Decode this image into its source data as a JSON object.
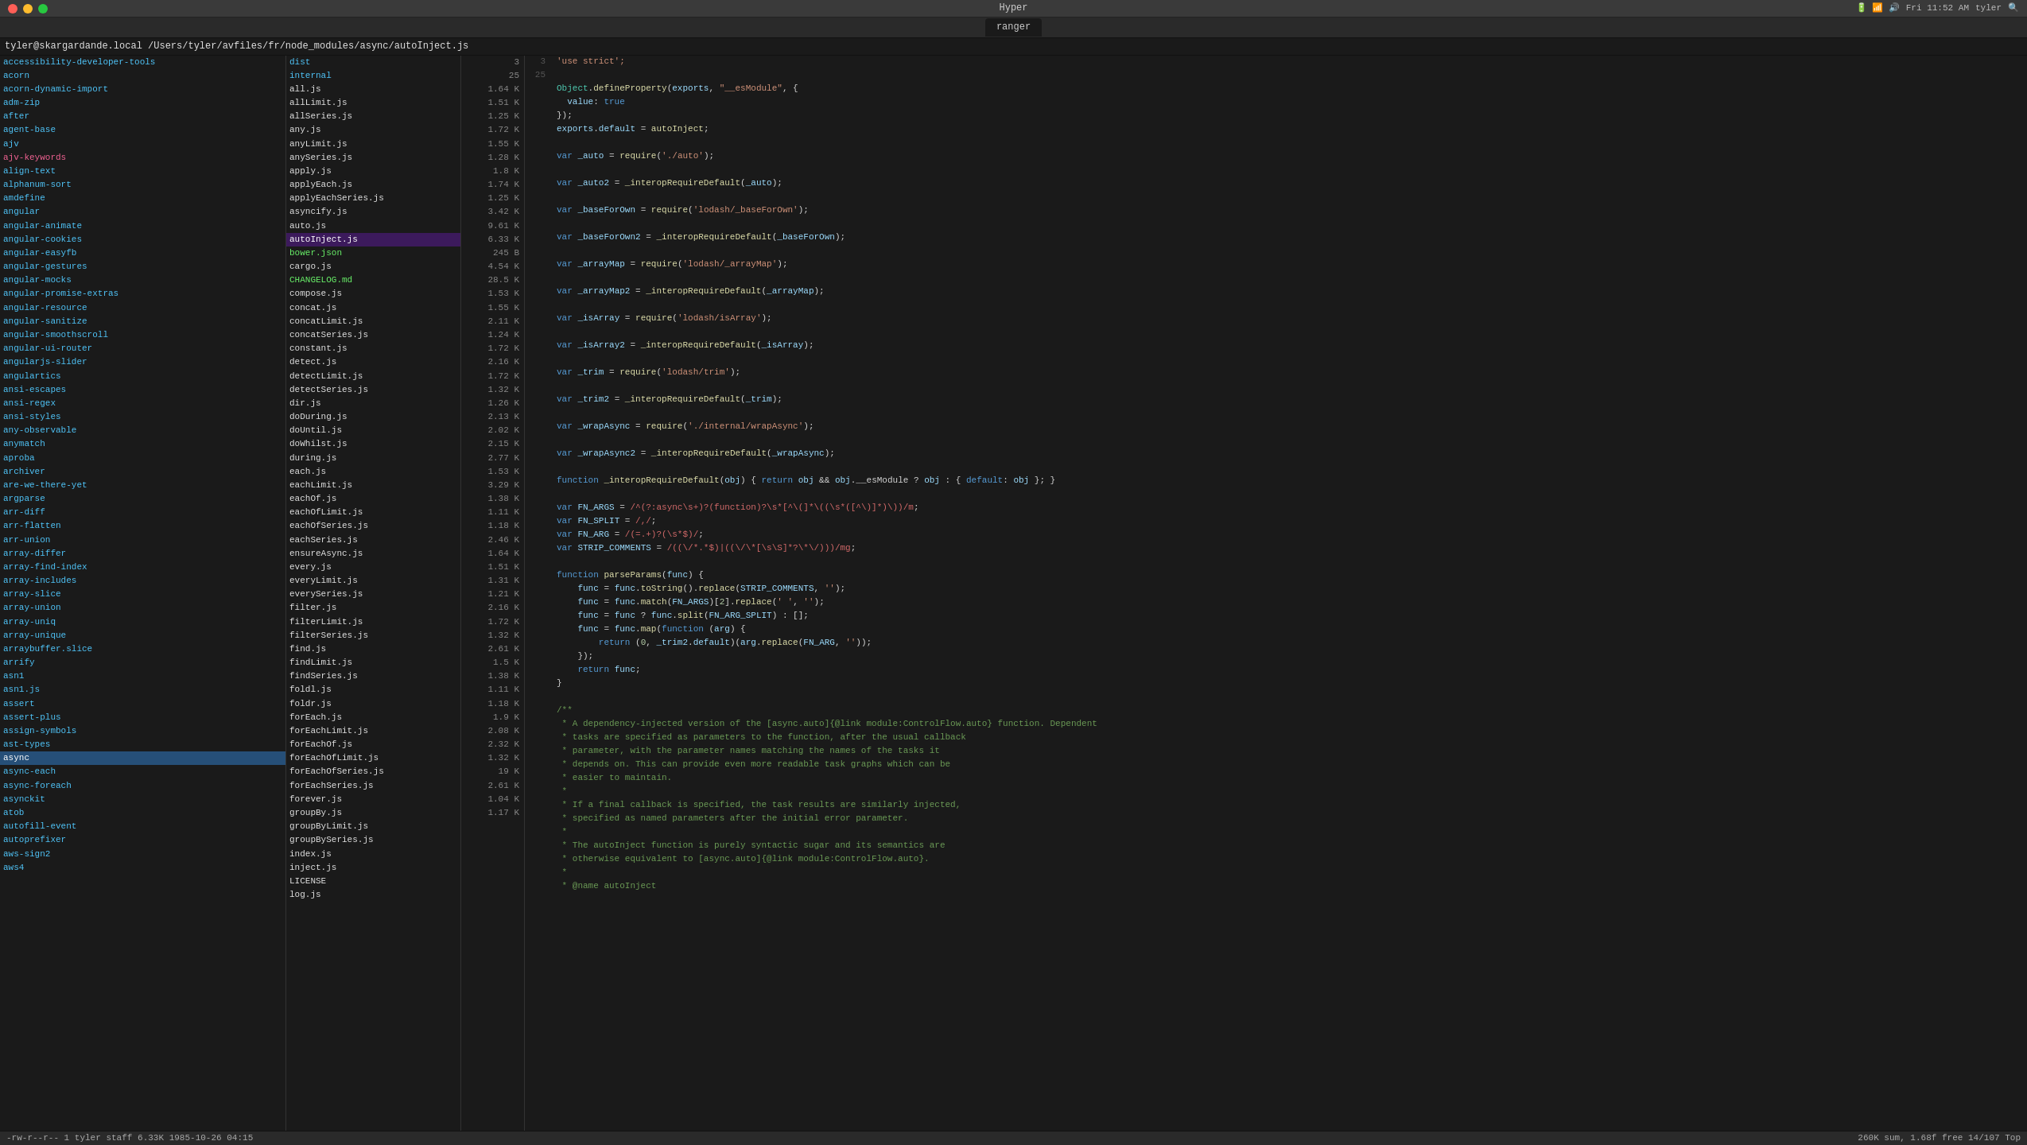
{
  "titlebar": {
    "app_name": "Hyper",
    "time": "Fri 11:52 AM",
    "tab_label": "ranger"
  },
  "pathbar": {
    "text": "tyler@skargardande.local /Users/tyler/avfiles/fr/node_modules/async/autoInject.js"
  },
  "left_files": [
    {
      "name": "accessibility-developer-tools",
      "color": "cyan"
    },
    {
      "name": "acorn",
      "color": "cyan"
    },
    {
      "name": "acorn-dynamic-import",
      "color": "cyan"
    },
    {
      "name": "adm-zip",
      "color": "cyan"
    },
    {
      "name": "after",
      "color": "cyan"
    },
    {
      "name": "agent-base",
      "color": "cyan"
    },
    {
      "name": "ajv",
      "color": "cyan"
    },
    {
      "name": "ajv-keywords",
      "color": "magenta"
    },
    {
      "name": "align-text",
      "color": "cyan"
    },
    {
      "name": "alphanum-sort",
      "color": "cyan"
    },
    {
      "name": "amdefine",
      "color": "cyan"
    },
    {
      "name": "angular",
      "color": "cyan"
    },
    {
      "name": "angular-animate",
      "color": "cyan"
    },
    {
      "name": "angular-cookies",
      "color": "cyan"
    },
    {
      "name": "angular-easyfb",
      "color": "cyan"
    },
    {
      "name": "angular-gestures",
      "color": "cyan"
    },
    {
      "name": "angular-mocks",
      "color": "cyan"
    },
    {
      "name": "angular-promise-extras",
      "color": "cyan"
    },
    {
      "name": "angular-resource",
      "color": "cyan"
    },
    {
      "name": "angular-sanitize",
      "color": "cyan"
    },
    {
      "name": "angular-smoothscroll",
      "color": "cyan"
    },
    {
      "name": "angular-ui-router",
      "color": "cyan"
    },
    {
      "name": "angularjs-slider",
      "color": "cyan"
    },
    {
      "name": "angulartics",
      "color": "cyan"
    },
    {
      "name": "ansi-escapes",
      "color": "cyan"
    },
    {
      "name": "ansi-regex",
      "color": "cyan"
    },
    {
      "name": "ansi-styles",
      "color": "cyan"
    },
    {
      "name": "any-observable",
      "color": "cyan"
    },
    {
      "name": "anymatch",
      "color": "cyan"
    },
    {
      "name": "aproba",
      "color": "cyan"
    },
    {
      "name": "archiver",
      "color": "cyan"
    },
    {
      "name": "are-we-there-yet",
      "color": "cyan"
    },
    {
      "name": "argparse",
      "color": "cyan"
    },
    {
      "name": "arr-diff",
      "color": "cyan"
    },
    {
      "name": "arr-flatten",
      "color": "cyan"
    },
    {
      "name": "arr-union",
      "color": "cyan"
    },
    {
      "name": "array-differ",
      "color": "cyan"
    },
    {
      "name": "array-find-index",
      "color": "cyan"
    },
    {
      "name": "array-includes",
      "color": "cyan"
    },
    {
      "name": "array-slice",
      "color": "cyan"
    },
    {
      "name": "array-union",
      "color": "cyan"
    },
    {
      "name": "array-uniq",
      "color": "cyan"
    },
    {
      "name": "array-unique",
      "color": "cyan"
    },
    {
      "name": "arraybuffer.slice",
      "color": "cyan"
    },
    {
      "name": "arrify",
      "color": "cyan"
    },
    {
      "name": "asn1",
      "color": "cyan"
    },
    {
      "name": "asn1.js",
      "color": "cyan"
    },
    {
      "name": "assert",
      "color": "cyan"
    },
    {
      "name": "assert-plus",
      "color": "cyan"
    },
    {
      "name": "assign-symbols",
      "color": "cyan"
    },
    {
      "name": "ast-types",
      "color": "cyan"
    },
    {
      "name": "async",
      "color": "selected"
    },
    {
      "name": "async-each",
      "color": "cyan"
    },
    {
      "name": "async-foreach",
      "color": "cyan"
    },
    {
      "name": "asynckit",
      "color": "cyan"
    },
    {
      "name": "atob",
      "color": "cyan"
    },
    {
      "name": "autofill-event",
      "color": "cyan"
    },
    {
      "name": "autoprefixer",
      "color": "cyan"
    },
    {
      "name": "aws-sign2",
      "color": "cyan"
    },
    {
      "name": "aws4",
      "color": "cyan"
    }
  ],
  "mid_files": [
    {
      "name": "dist",
      "selected": false
    },
    {
      "name": "internal",
      "selected": false
    },
    {
      "name": "all.js",
      "selected": false
    },
    {
      "name": "allLimit.js",
      "selected": false
    },
    {
      "name": "allSeries.js",
      "selected": false
    },
    {
      "name": "any.js",
      "selected": false
    },
    {
      "name": "anyLimit.js",
      "selected": false
    },
    {
      "name": "anySeries.js",
      "selected": false
    },
    {
      "name": "apply.js",
      "selected": false
    },
    {
      "name": "applyEach.js",
      "selected": false
    },
    {
      "name": "applyEachSeries.js",
      "selected": false
    },
    {
      "name": "asyncify.js",
      "selected": false
    },
    {
      "name": "auto.js",
      "selected": false
    },
    {
      "name": "autoInject.js",
      "selected": true
    },
    {
      "name": "bower.json",
      "selected": false
    },
    {
      "name": "cargo.js",
      "selected": false
    },
    {
      "name": "CHANGELOG.md",
      "selected": false
    },
    {
      "name": "compose.js",
      "selected": false
    },
    {
      "name": "concat.js",
      "selected": false
    },
    {
      "name": "concatLimit.js",
      "selected": false
    },
    {
      "name": "concatSeries.js",
      "selected": false
    },
    {
      "name": "constant.js",
      "selected": false
    },
    {
      "name": "detect.js",
      "selected": false
    },
    {
      "name": "detectLimit.js",
      "selected": false
    },
    {
      "name": "detectSeries.js",
      "selected": false
    },
    {
      "name": "dir.js",
      "selected": false
    },
    {
      "name": "doDuring.js",
      "selected": false
    },
    {
      "name": "doUntil.js",
      "selected": false
    },
    {
      "name": "doWhilst.js",
      "selected": false
    },
    {
      "name": "during.js",
      "selected": false
    },
    {
      "name": "each.js",
      "selected": false
    },
    {
      "name": "eachLimit.js",
      "selected": false
    },
    {
      "name": "eachOf.js",
      "selected": false
    },
    {
      "name": "eachOfLimit.js",
      "selected": false
    },
    {
      "name": "eachOfSeries.js",
      "selected": false
    },
    {
      "name": "eachSeries.js",
      "selected": false
    },
    {
      "name": "ensureAsync.js",
      "selected": false
    },
    {
      "name": "every.js",
      "selected": false
    },
    {
      "name": "everyLimit.js",
      "selected": false
    },
    {
      "name": "everySeries.js",
      "selected": false
    },
    {
      "name": "filter.js",
      "selected": false
    },
    {
      "name": "filterLimit.js",
      "selected": false
    },
    {
      "name": "filterSeries.js",
      "selected": false
    },
    {
      "name": "find.js",
      "selected": false
    },
    {
      "name": "findLimit.js",
      "selected": false
    },
    {
      "name": "findSeries.js",
      "selected": false
    },
    {
      "name": "foldl.js",
      "selected": false
    },
    {
      "name": "foldr.js",
      "selected": false
    },
    {
      "name": "forEach.js",
      "selected": false
    },
    {
      "name": "forEachLimit.js",
      "selected": false
    },
    {
      "name": "forEachOf.js",
      "selected": false
    },
    {
      "name": "forEachOfLimit.js",
      "selected": false
    },
    {
      "name": "forEachOfSeries.js",
      "selected": false
    },
    {
      "name": "forEachSeries.js",
      "selected": false
    },
    {
      "name": "forever.js",
      "selected": false
    },
    {
      "name": "groupBy.js",
      "selected": false
    },
    {
      "name": "groupByLimit.js",
      "selected": false
    },
    {
      "name": "groupBySeries.js",
      "selected": false
    },
    {
      "name": "index.js",
      "selected": false
    },
    {
      "name": "inject.js",
      "selected": false
    },
    {
      "name": "LICENSE",
      "selected": false
    },
    {
      "name": "log.js",
      "selected": false
    }
  ],
  "sizes": [
    {
      "val": "3",
      "unit": ""
    },
    {
      "val": "25",
      "unit": ""
    },
    {
      "val": "1.64 K",
      "unit": ""
    },
    {
      "val": "1.51 K",
      "unit": ""
    },
    {
      "val": "1.25 K",
      "unit": ""
    },
    {
      "val": "1.72 K",
      "unit": ""
    },
    {
      "val": "1.55 K",
      "unit": ""
    },
    {
      "val": "1.28 K",
      "unit": ""
    },
    {
      "val": "1.8 K",
      "unit": ""
    },
    {
      "val": "1.74 K",
      "unit": ""
    },
    {
      "val": "1.25 K",
      "unit": ""
    },
    {
      "val": "3.42 K",
      "unit": ""
    },
    {
      "val": "9.61 K",
      "unit": ""
    },
    {
      "val": "6.33 K",
      "unit": ""
    },
    {
      "val": "245 B",
      "unit": ""
    },
    {
      "val": "4.54 K",
      "unit": ""
    },
    {
      "val": "28.5 K",
      "unit": ""
    },
    {
      "val": "1.53 K",
      "unit": ""
    },
    {
      "val": "1.55 K",
      "unit": ""
    },
    {
      "val": "2.11 K",
      "unit": ""
    },
    {
      "val": "1.24 K",
      "unit": ""
    },
    {
      "val": "1.72 K",
      "unit": ""
    },
    {
      "val": "2.16 K",
      "unit": ""
    },
    {
      "val": "1.72 K",
      "unit": ""
    },
    {
      "val": "1.32 K",
      "unit": ""
    },
    {
      "val": "1.26 K",
      "unit": ""
    },
    {
      "val": "2.13 K",
      "unit": ""
    },
    {
      "val": "2.02 K",
      "unit": ""
    },
    {
      "val": "2.15 K",
      "unit": ""
    },
    {
      "val": "2.77 K",
      "unit": ""
    },
    {
      "val": "1.53 K",
      "unit": ""
    },
    {
      "val": "3.29 K",
      "unit": ""
    },
    {
      "val": "1.38 K",
      "unit": ""
    },
    {
      "val": "1.11 K",
      "unit": ""
    },
    {
      "val": "1.18 K",
      "unit": ""
    },
    {
      "val": "2.46 K",
      "unit": ""
    },
    {
      "val": "1.64 K",
      "unit": ""
    },
    {
      "val": "1.51 K",
      "unit": ""
    },
    {
      "val": "1.31 K",
      "unit": ""
    },
    {
      "val": "1.21 K",
      "unit": ""
    },
    {
      "val": "2.16 K",
      "unit": ""
    },
    {
      "val": "1.72 K",
      "unit": ""
    },
    {
      "val": "1.32 K",
      "unit": ""
    },
    {
      "val": "2.61 K",
      "unit": ""
    },
    {
      "val": "1.5 K",
      "unit": ""
    },
    {
      "val": "1.38 K",
      "unit": ""
    },
    {
      "val": "1.11 K",
      "unit": ""
    },
    {
      "val": "1.18 K",
      "unit": ""
    },
    {
      "val": "1.9 K",
      "unit": ""
    },
    {
      "val": "2.08 K",
      "unit": ""
    },
    {
      "val": "2.32 K",
      "unit": ""
    },
    {
      "val": "1.32 K",
      "unit": ""
    },
    {
      "val": "19 K",
      "unit": ""
    },
    {
      "val": "2.61 K",
      "unit": ""
    },
    {
      "val": "1.04 K",
      "unit": ""
    },
    {
      "val": "1.17 K",
      "unit": ""
    }
  ],
  "code": {
    "lines": [
      {
        "no": "3",
        "content": "'use strict';",
        "tokens": [
          {
            "text": "'use strict';",
            "cls": "str"
          }
        ]
      },
      {
        "no": "25",
        "content": ""
      },
      {
        "no": "",
        "content": "Object.defineProperty(exports, \"__esModule\", {"
      },
      {
        "no": "",
        "content": "  value: true"
      },
      {
        "no": "",
        "content": "});"
      },
      {
        "no": "",
        "content": "exports.default = autoInject;"
      },
      {
        "no": "",
        "content": ""
      },
      {
        "no": "",
        "content": "var _auto = require('./auto');"
      },
      {
        "no": "",
        "content": ""
      },
      {
        "no": "",
        "content": "var _auto2 = _interopRequireDefault(_auto);"
      },
      {
        "no": "",
        "content": ""
      },
      {
        "no": "",
        "content": "var _baseForOwn = require('lodash/_baseForOwn');"
      },
      {
        "no": "",
        "content": ""
      },
      {
        "no": "",
        "content": "var _baseForOwn2 = _interopRequireDefault(_baseForOwn);"
      },
      {
        "no": "",
        "content": ""
      },
      {
        "no": "",
        "content": "var _arrayMap = require('lodash/_arrayMap');"
      },
      {
        "no": "",
        "content": ""
      },
      {
        "no": "",
        "content": "var _arrayMap2 = _interopRequireDefault(_arrayMap);"
      },
      {
        "no": "",
        "content": ""
      },
      {
        "no": "",
        "content": "var _isArray = require('lodash/isArray');"
      },
      {
        "no": "",
        "content": ""
      },
      {
        "no": "",
        "content": "var _isArray2 = _interopRequireDefault(_isArray);"
      },
      {
        "no": "",
        "content": ""
      },
      {
        "no": "",
        "content": "var _trim = require('lodash/trim');"
      },
      {
        "no": "",
        "content": ""
      },
      {
        "no": "",
        "content": "var _trim2 = _interopRequireDefault(_trim);"
      },
      {
        "no": "",
        "content": ""
      },
      {
        "no": "",
        "content": "var _wrapAsync = require('./internal/wrapAsync');"
      },
      {
        "no": "",
        "content": ""
      },
      {
        "no": "",
        "content": "var _wrapAsync2 = _interopRequireDefault(_wrapAsync);"
      },
      {
        "no": "",
        "content": ""
      },
      {
        "no": "",
        "content": "function _interopRequireDefault(obj) { return obj && obj.__esModule ? obj : { default: obj }; }"
      },
      {
        "no": "",
        "content": ""
      },
      {
        "no": "",
        "content": "var FN_ARGS = /^(?:async\\s+)?(function)?\\s*[^\\(]*\\((\\s*([^\\)]*)\\))/m;"
      },
      {
        "no": "",
        "content": "var FN_SPLIT = /,/;"
      },
      {
        "no": "",
        "content": "var FN_ARG = /(=.+)?(\\s*$)/;"
      },
      {
        "no": "",
        "content": "var STRIP_COMMENTS = /((\\/*.*$)|((\\/*[\\s\\S]*?\\*\\/)))/mg;"
      },
      {
        "no": "",
        "content": ""
      },
      {
        "no": "",
        "content": "function parseParams(func) {"
      },
      {
        "no": "",
        "content": "    func = func.toString().replace(STRIP_COMMENTS, '');"
      },
      {
        "no": "",
        "content": "    func = func.match(FN_ARGS)[2].replace(' ', '');"
      },
      {
        "no": "",
        "content": "    func = func ? func.split(FN_ARG_SPLIT) : [];"
      },
      {
        "no": "",
        "content": "    func = func.map(function (arg) {"
      },
      {
        "no": "",
        "content": "        return (0, _trim2.default)(arg.replace(FN_ARG, ''));"
      },
      {
        "no": "",
        "content": "    });"
      },
      {
        "no": "",
        "content": "    return func;"
      },
      {
        "no": "",
        "content": "}"
      },
      {
        "no": "",
        "content": ""
      },
      {
        "no": "",
        "content": "/**"
      },
      {
        "no": "",
        "content": " * A dependency-injected version of the [async.auto]{@link module:ControlFlow.auto} function. Dependent"
      },
      {
        "no": "",
        "content": " * tasks are specified as parameters to the function, after the usual callback"
      },
      {
        "no": "",
        "content": " * parameter, with the parameter names matching the names of the tasks it"
      },
      {
        "no": "",
        "content": " * depends on. This can provide even more readable task graphs which can be"
      },
      {
        "no": "",
        "content": " * easier to maintain."
      },
      {
        "no": "",
        "content": " *"
      },
      {
        "no": "",
        "content": " * If a final callback is specified, the task results are similarly injected,"
      },
      {
        "no": "",
        "content": " * specified as named parameters after the initial error parameter."
      },
      {
        "no": "",
        "content": " *"
      },
      {
        "no": "",
        "content": " * The autoInject function is purely syntactic sugar and its semantics are"
      },
      {
        "no": "",
        "content": " * otherwise equivalent to [async.auto]{@link module:ControlFlow.auto}."
      },
      {
        "no": "",
        "content": " *"
      },
      {
        "no": "",
        "content": " * @name autoInject"
      }
    ]
  },
  "statusbar": {
    "left": "-rw-r--r--  1 tyler  staff  6.33K 1985-10-26 04:15",
    "right": "260K sum, 1.68f free  14/107  Top"
  }
}
